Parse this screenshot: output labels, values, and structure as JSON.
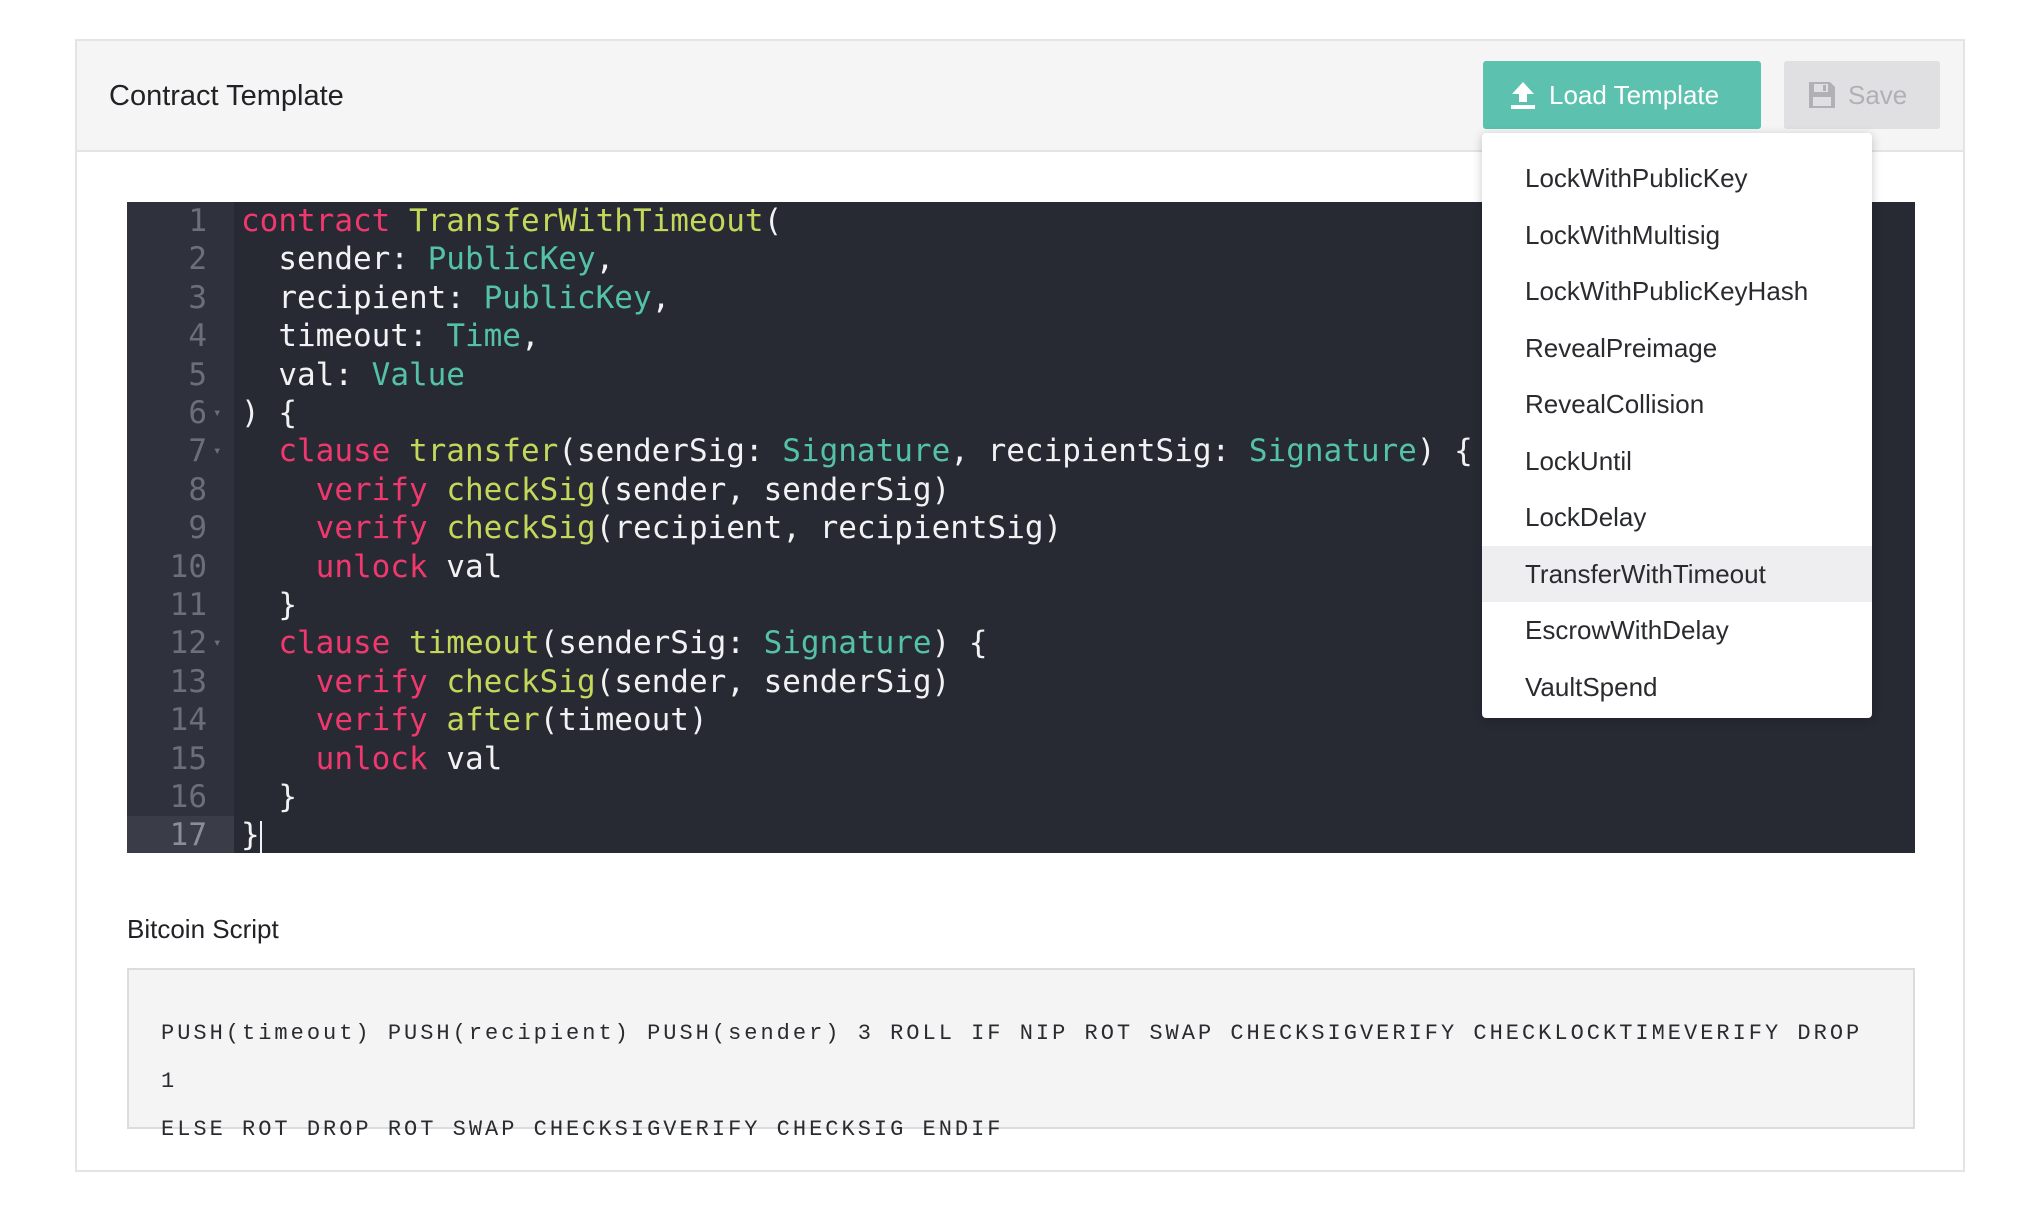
{
  "panel": {
    "title": "Contract Template",
    "load_label": "Load Template",
    "save_label": "Save"
  },
  "editor": {
    "lines": [
      {
        "n": "1",
        "tokens": [
          [
            "kw",
            "contract"
          ],
          [
            "t",
            " "
          ],
          [
            "fn",
            "TransferWithTimeout"
          ],
          [
            "t",
            "("
          ]
        ]
      },
      {
        "n": "2",
        "tokens": [
          [
            "t",
            "  sender: "
          ],
          [
            "ty",
            "PublicKey"
          ],
          [
            "t",
            ","
          ]
        ]
      },
      {
        "n": "3",
        "tokens": [
          [
            "t",
            "  recipient: "
          ],
          [
            "ty",
            "PublicKey"
          ],
          [
            "t",
            ","
          ]
        ]
      },
      {
        "n": "4",
        "tokens": [
          [
            "t",
            "  timeout: "
          ],
          [
            "ty",
            "Time"
          ],
          [
            "t",
            ","
          ]
        ]
      },
      {
        "n": "5",
        "tokens": [
          [
            "t",
            "  val: "
          ],
          [
            "ty",
            "Value"
          ]
        ]
      },
      {
        "n": "6",
        "tokens": [
          [
            "t",
            ") {"
          ]
        ]
      },
      {
        "n": "7",
        "tokens": [
          [
            "t",
            "  "
          ],
          [
            "kw",
            "clause"
          ],
          [
            "t",
            " "
          ],
          [
            "fn",
            "transfer"
          ],
          [
            "t",
            "(senderSig: "
          ],
          [
            "ty",
            "Signature"
          ],
          [
            "t",
            ", recipientSig: "
          ],
          [
            "ty",
            "Signature"
          ],
          [
            "t",
            ") {"
          ]
        ]
      },
      {
        "n": "8",
        "tokens": [
          [
            "t",
            "    "
          ],
          [
            "kw",
            "verify"
          ],
          [
            "t",
            " "
          ],
          [
            "fn",
            "checkSig"
          ],
          [
            "t",
            "(sender, senderSig)"
          ]
        ]
      },
      {
        "n": "9",
        "tokens": [
          [
            "t",
            "    "
          ],
          [
            "kw",
            "verify"
          ],
          [
            "t",
            " "
          ],
          [
            "fn",
            "checkSig"
          ],
          [
            "t",
            "(recipient, recipientSig)"
          ]
        ]
      },
      {
        "n": "10",
        "tokens": [
          [
            "t",
            "    "
          ],
          [
            "kw",
            "unlock"
          ],
          [
            "t",
            " val"
          ]
        ]
      },
      {
        "n": "11",
        "tokens": [
          [
            "t",
            "  }"
          ]
        ]
      },
      {
        "n": "12",
        "tokens": [
          [
            "t",
            "  "
          ],
          [
            "kw",
            "clause"
          ],
          [
            "t",
            " "
          ],
          [
            "fn",
            "timeout"
          ],
          [
            "t",
            "(senderSig: "
          ],
          [
            "ty",
            "Signature"
          ],
          [
            "t",
            ") {"
          ]
        ]
      },
      {
        "n": "13",
        "tokens": [
          [
            "t",
            "    "
          ],
          [
            "kw",
            "verify"
          ],
          [
            "t",
            " "
          ],
          [
            "fn",
            "checkSig"
          ],
          [
            "t",
            "(sender, senderSig)"
          ]
        ]
      },
      {
        "n": "14",
        "tokens": [
          [
            "t",
            "    "
          ],
          [
            "kw",
            "verify"
          ],
          [
            "t",
            " "
          ],
          [
            "fn",
            "after"
          ],
          [
            "t",
            "(timeout)"
          ]
        ]
      },
      {
        "n": "15",
        "tokens": [
          [
            "t",
            "    "
          ],
          [
            "kw",
            "unlock"
          ],
          [
            "t",
            " val"
          ]
        ]
      },
      {
        "n": "16",
        "tokens": [
          [
            "t",
            "  }"
          ]
        ]
      },
      {
        "n": "17",
        "tokens": [
          [
            "t",
            "}"
          ]
        ]
      }
    ],
    "fold_lines": [
      "6",
      "7",
      "12"
    ],
    "active_line": "17"
  },
  "script": {
    "title": "Bitcoin Script",
    "line1": "PUSH(timeout) PUSH(recipient) PUSH(sender) 3 ROLL IF NIP ROT SWAP CHECKSIGVERIFY CHECKLOCKTIMEVERIFY DROP 1",
    "line2": "ELSE ROT DROP ROT SWAP CHECKSIGVERIFY CHECKSIG ENDIF"
  },
  "dropdown": {
    "items": [
      "LockWithPublicKey",
      "LockWithMultisig",
      "LockWithPublicKeyHash",
      "RevealPreimage",
      "RevealCollision",
      "LockUntil",
      "LockDelay",
      "TransferWithTimeout",
      "EscrowWithDelay",
      "VaultSpend"
    ],
    "selected": "TransferWithTimeout"
  },
  "colors": {
    "accent": "#5cc1ae",
    "editor_bg": "#272a33",
    "keyword": "#f1386e",
    "function": "#c2d85b",
    "type": "#54c2a6"
  },
  "icons": {
    "load": "upload-icon",
    "save": "floppy-disk-icon"
  }
}
